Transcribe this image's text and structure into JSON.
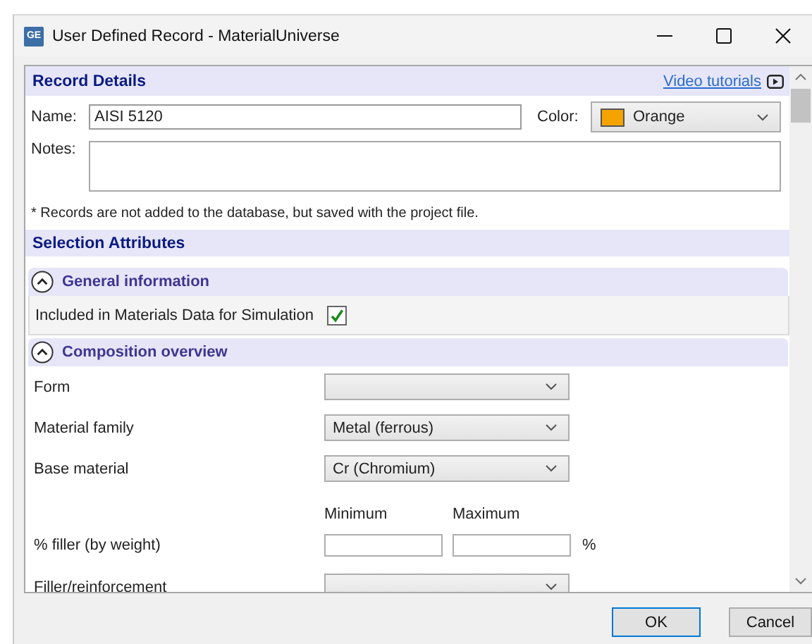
{
  "window": {
    "title": "User Defined Record - MaterialUniverse",
    "app_badge": "GE"
  },
  "record_details": {
    "title": "Record Details",
    "video_link": "Video tutorials",
    "name_label": "Name:",
    "name_value": "AISI 5120",
    "color_label": "Color:",
    "color_value": "Orange",
    "color": "#f5a300",
    "notes_label": "Notes:",
    "footnote": "* Records are not added to the database, but saved with the project file."
  },
  "selection_attributes": {
    "title": "Selection Attributes",
    "sections": [
      {
        "title": "General information",
        "expanded": true,
        "rows": [
          {
            "kind": "checkbox",
            "label": "Included in Materials Data for Simulation",
            "checked": true
          }
        ]
      },
      {
        "title": "Composition overview",
        "expanded": true,
        "rows": [
          {
            "kind": "dropdown",
            "label": "Form"
          },
          {
            "kind": "dropdown",
            "label": "Material family",
            "value": "Metal (ferrous)"
          },
          {
            "kind": "dropdown",
            "label": "Base material",
            "value": "Cr (Chromium)"
          },
          {
            "kind": "range_header",
            "column_1": "Minimum",
            "column_2": "Maximum"
          },
          {
            "kind": "range",
            "label": "% filler (by weight)",
            "unit": "%"
          },
          {
            "kind": "dropdown",
            "label": "Filler/reinforcement"
          }
        ]
      }
    ]
  },
  "buttons": [
    {
      "label": "OK",
      "default": true
    },
    {
      "label": "Cancel",
      "default": false
    }
  ]
}
